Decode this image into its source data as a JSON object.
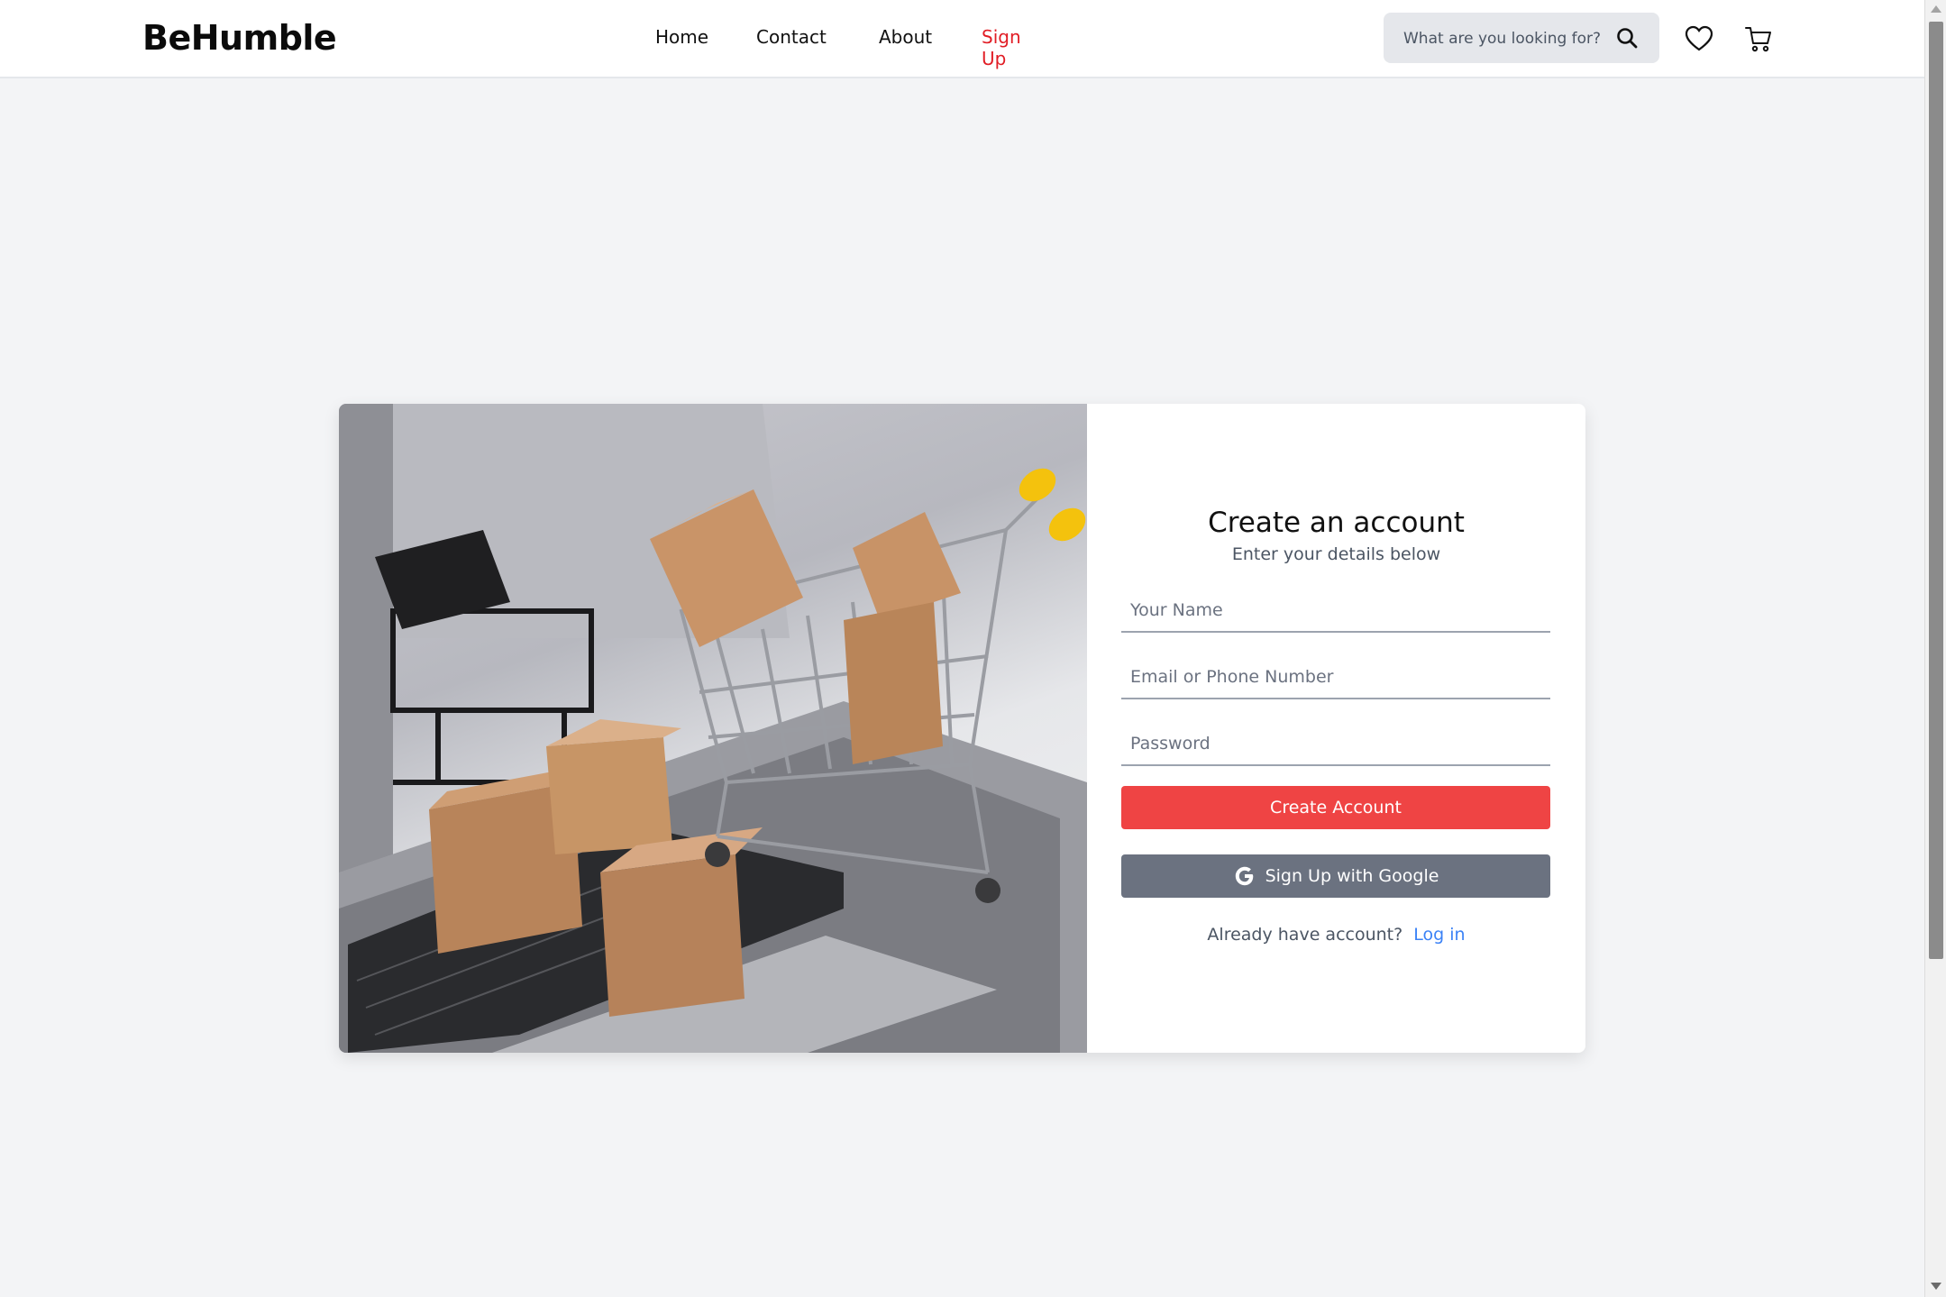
{
  "header": {
    "logo": "BeHumble",
    "nav": [
      {
        "label": "Home"
      },
      {
        "label": "Contact"
      },
      {
        "label": "About"
      },
      {
        "label": "Sign Up",
        "active": true
      }
    ],
    "search": {
      "placeholder": "What are you looking for?",
      "icon": "search-icon"
    },
    "icons": [
      "heart-icon",
      "cart-icon"
    ]
  },
  "hero_image": {
    "alt": "Shopping cart with cardboard boxes on a laptop keyboard"
  },
  "form": {
    "title": "Create an account",
    "subtitle": "Enter your details below",
    "name_placeholder": "Your Name",
    "email_placeholder": "Email or Phone Number",
    "password_placeholder": "Password",
    "create_label": "Create Account",
    "google_label": "Sign Up with Google",
    "login_prompt": "Already have account?",
    "login_link": "Log in"
  },
  "colors": {
    "accent": "#ef4444",
    "active_nav": "#e11d25",
    "google_button": "#6b7280",
    "link": "#3b82f6",
    "page_bg": "#f3f4f6"
  }
}
